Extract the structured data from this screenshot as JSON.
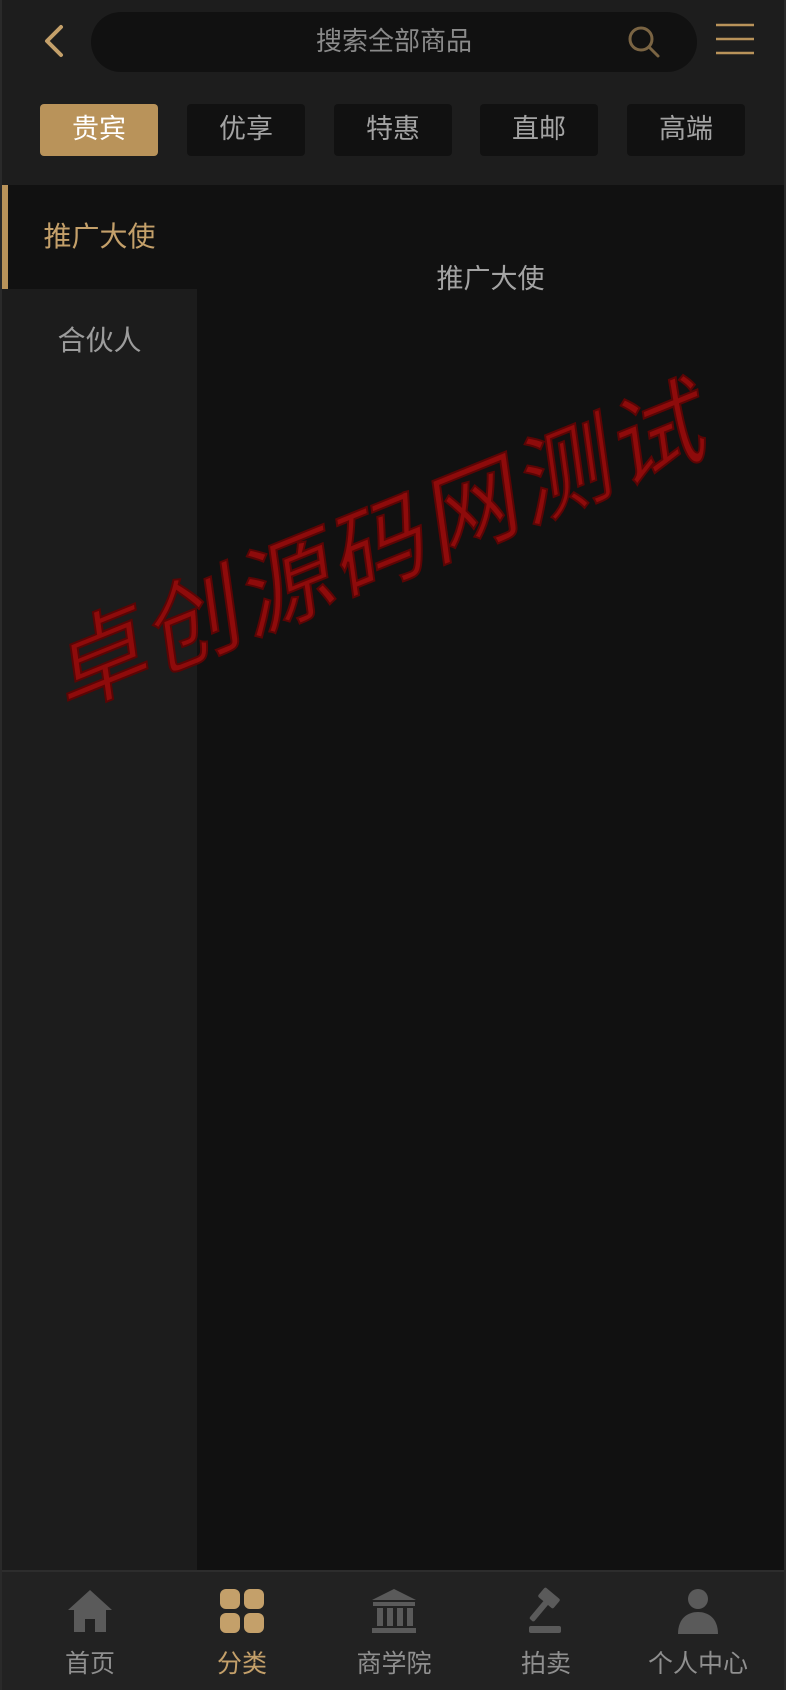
{
  "header": {
    "back_icon": "chevron-left-icon",
    "search_placeholder": "搜索全部商品",
    "search_icon": "search-icon",
    "menu_icon": "menu-icon"
  },
  "tabs": [
    {
      "label": "贵宾",
      "active": true
    },
    {
      "label": "优享",
      "active": false
    },
    {
      "label": "特惠",
      "active": false
    },
    {
      "label": "直邮",
      "active": false
    },
    {
      "label": "高端",
      "active": false
    }
  ],
  "sidebar": {
    "items": [
      {
        "label": "推广大使",
        "active": true
      },
      {
        "label": "合伙人",
        "active": false
      }
    ]
  },
  "content": {
    "title": "推广大使"
  },
  "watermark": {
    "text": "卓创源码网测试"
  },
  "bottom_nav": {
    "items": [
      {
        "label": "首页",
        "icon": "home-icon",
        "active": false
      },
      {
        "label": "分类",
        "icon": "category-icon",
        "active": true
      },
      {
        "label": "商学院",
        "icon": "academy-icon",
        "active": false
      },
      {
        "label": "拍卖",
        "icon": "auction-icon",
        "active": false
      },
      {
        "label": "个人中心",
        "icon": "user-icon",
        "active": false
      }
    ]
  },
  "colors": {
    "accent": "#b9935a",
    "accent_text": "#c4a06a",
    "background": "#1d1d1d",
    "panel": "#111111",
    "watermark": "#8e0b0b"
  }
}
